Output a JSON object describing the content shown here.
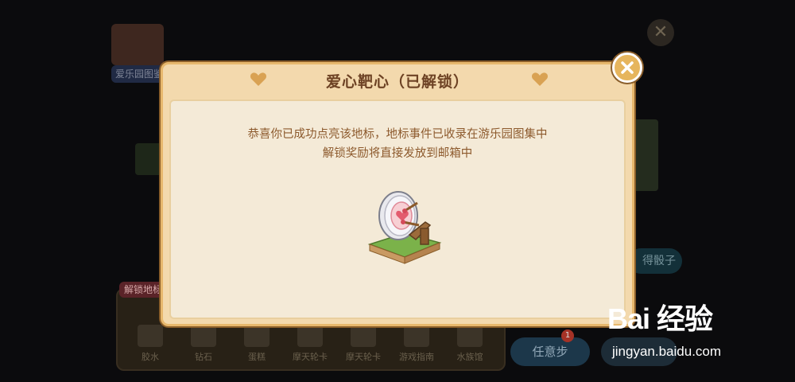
{
  "background": {
    "album_label": "爱乐园图鉴",
    "unlock_tag": "解锁地标",
    "dice_reward_label": "得骰子",
    "unlock_items": [
      "胶水",
      "钻石",
      "蛋糕",
      "摩天轮卡",
      "摩天轮卡",
      "游戏指南",
      "水族馆"
    ],
    "any_step_label": "任意步",
    "any_step_badge": "1"
  },
  "modal": {
    "title": "爱心靶心（已解锁）",
    "description_line1": "恭喜你已成功点亮该地标，地标事件已收录在游乐园图集中",
    "description_line2": "解锁奖励将直接发放到邮箱中",
    "item_icon": "heart-target-icon"
  },
  "close_icon": "close-icon",
  "watermark": {
    "brand": "Bai 经验",
    "url": "jingyan.baidu.com"
  },
  "colors": {
    "modal_frame": "#f3d9ad",
    "modal_body": "#f4ead7",
    "title_text": "#6d4224",
    "body_text": "#8d5a2d",
    "close_button": "#e6b55d"
  }
}
